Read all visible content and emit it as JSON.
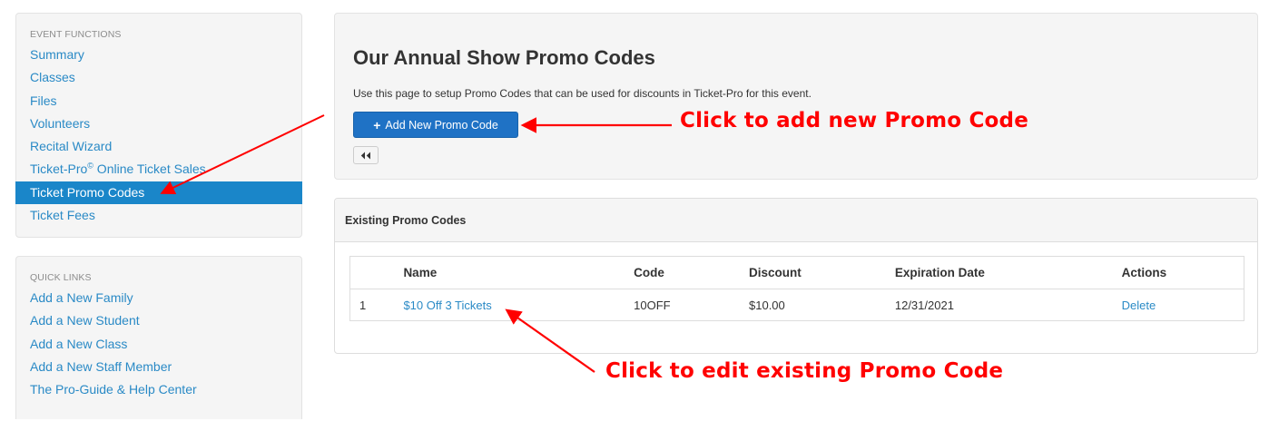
{
  "sidebar": {
    "event_functions": {
      "heading": "EVENT FUNCTIONS",
      "items": [
        {
          "label": "Summary"
        },
        {
          "label": "Classes"
        },
        {
          "label": "Files"
        },
        {
          "label": "Volunteers"
        },
        {
          "label": "Recital Wizard"
        },
        {
          "label": "Ticket-Pro",
          "sup": "©",
          "suffix": " Online Ticket Sales"
        },
        {
          "label": "Ticket Promo Codes",
          "active": true
        },
        {
          "label": "Ticket Fees"
        }
      ]
    },
    "quick_links": {
      "heading": "QUICK LINKS",
      "items": [
        {
          "label": "Add a New Family"
        },
        {
          "label": "Add a New Student"
        },
        {
          "label": "Add a New Class"
        },
        {
          "label": "Add a New Staff Member"
        },
        {
          "label": "The Pro-Guide & Help Center"
        }
      ]
    }
  },
  "main": {
    "title": "Our Annual Show Promo Codes",
    "description": "Use this page to setup Promo Codes that can be used for discounts in Ticket-Pro for this event.",
    "add_button_label": "Add New Promo Code",
    "add_button_icon": "+",
    "back_button_icon": "double-chevron-left-icon"
  },
  "existing": {
    "heading": "Existing Promo Codes",
    "columns": [
      "",
      "Name",
      "Code",
      "Discount",
      "Expiration Date",
      "Actions"
    ],
    "rows": [
      {
        "num": "1",
        "name": "$10 Off 3 Tickets",
        "code": "10OFF",
        "discount": "$10.00",
        "expiration": "12/31/2021",
        "action": "Delete"
      }
    ]
  },
  "annotations": {
    "add": "Click to add new Promo Code",
    "edit": "Click to edit existing Promo Code"
  },
  "colors": {
    "accent": "#1a86c9",
    "link": "#2a8ac6",
    "button": "#1f72c5",
    "annotation": "#ff0000"
  }
}
